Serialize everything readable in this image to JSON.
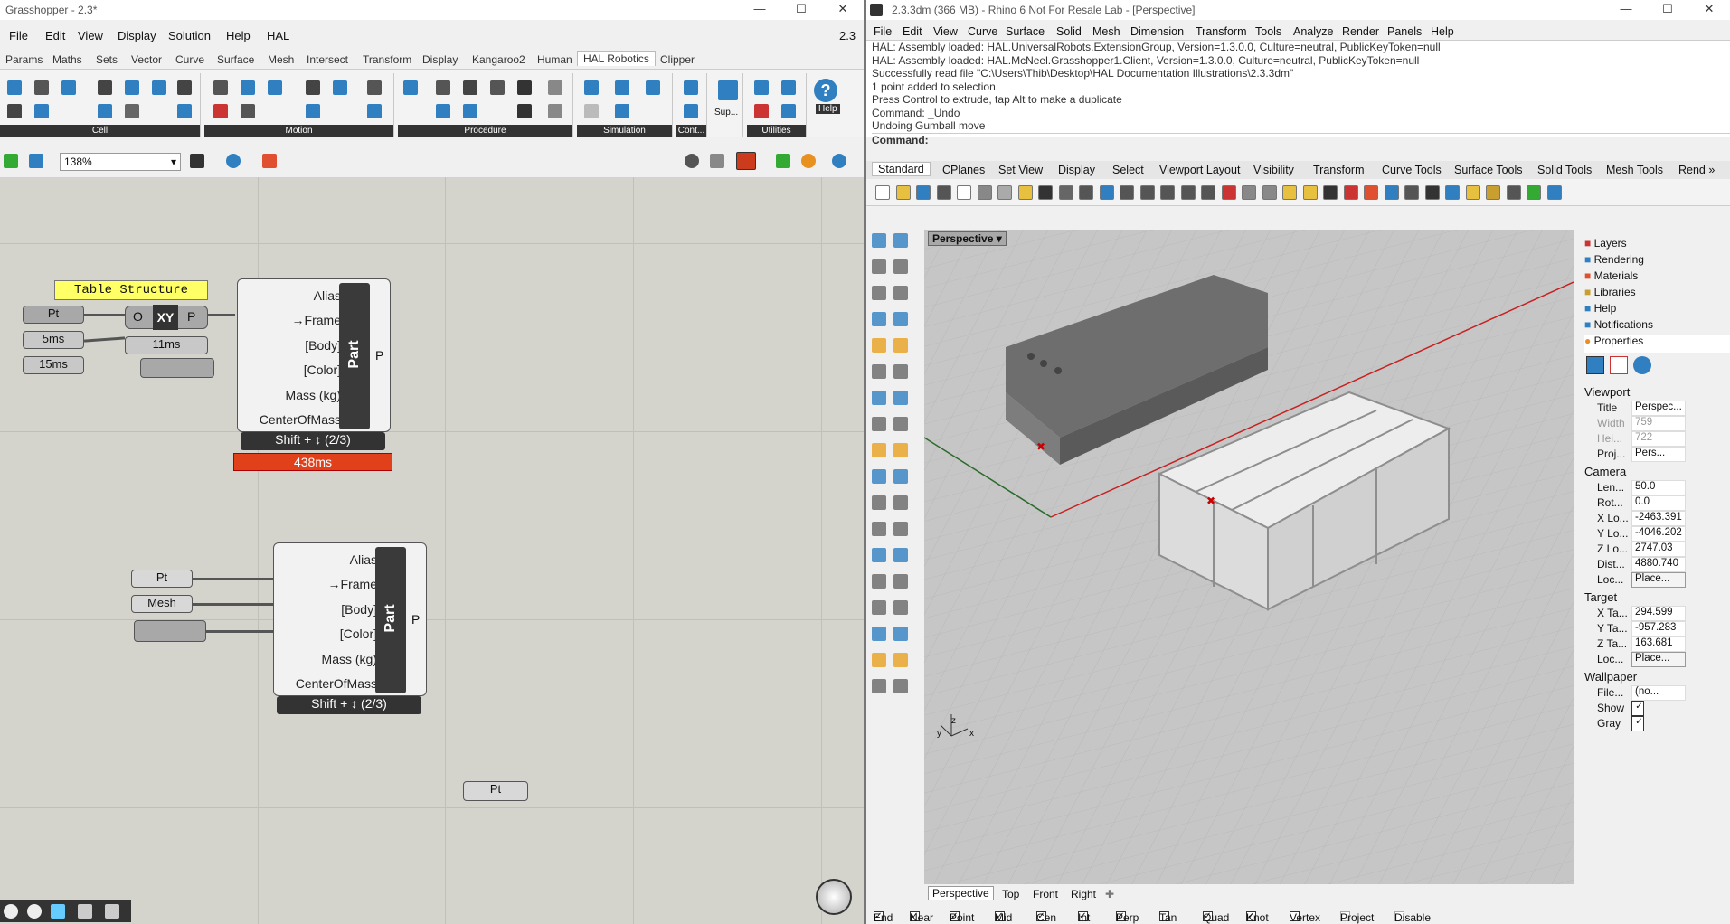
{
  "grasshopper": {
    "title": "Grasshopper - 2.3*",
    "version_badge": "2.3",
    "menu": [
      "File",
      "Edit",
      "View",
      "Display",
      "Solution",
      "Help",
      "HAL"
    ],
    "tabs": [
      "Params",
      "Maths",
      "Sets",
      "Vector",
      "Curve",
      "Surface",
      "Mesh",
      "Intersect",
      "Transform",
      "Display",
      "Kangaroo2",
      "Human",
      "HAL Robotics",
      "Clipper"
    ],
    "active_tab": "HAL Robotics",
    "groups": [
      "Cell",
      "Motion",
      "Procedure",
      "Simulation",
      "Cont...",
      "Utilities"
    ],
    "group_small_labels": {
      "sup": "Sup...",
      "cont": "Cont...",
      "help": "Help"
    },
    "zoom": "138%",
    "canvas": {
      "group_label": "Table Structure",
      "pt1": "Pt",
      "t5": "5ms",
      "t15": "15ms",
      "t11": "11ms",
      "xy_o": "O",
      "xy_p": "P",
      "part1": {
        "inputs": [
          "Alias",
          "→Frame",
          "[Body]",
          "[Color]",
          "Mass (kg)",
          "CenterOfMass"
        ],
        "name": "Part",
        "output": "P",
        "footer": "Shift + ↕ (2/3)",
        "timing": "438ms"
      },
      "part2": {
        "inputs": [
          "Alias",
          "→Frame",
          "[Body]",
          "[Color]",
          "Mass (kg)",
          "CenterOfMass"
        ],
        "name": "Part",
        "output": "P",
        "footer": "Shift + ↕ (2/3)"
      },
      "pt2": "Pt",
      "mesh": "Mesh",
      "pt3": "Pt"
    }
  },
  "rhino": {
    "title": "2.3.3dm (366 MB) - Rhino 6 Not For Resale Lab - [Perspective]",
    "menu": [
      "File",
      "Edit",
      "View",
      "Curve",
      "Surface",
      "Solid",
      "Mesh",
      "Dimension",
      "Transform",
      "Tools",
      "Analyze",
      "Render",
      "Panels",
      "Help"
    ],
    "log": [
      "HAL: Assembly loaded: HAL.UniversalRobots.ExtensionGroup, Version=1.3.0.0, Culture=neutral, PublicKeyToken=null",
      "HAL: Assembly loaded: HAL.McNeel.Grasshopper1.Client, Version=1.3.0.0, Culture=neutral, PublicKeyToken=null",
      "Successfully read file \"C:\\Users\\Thib\\Desktop\\HAL Documentation Illustrations\\2.3.3dm\"",
      "1 point added to selection.",
      "Press Control to extrude, tap Alt to make a duplicate",
      "Command: _Undo",
      "Undoing Gumball move"
    ],
    "command_label": "Command:",
    "toolbar_tabs": [
      "Standard",
      "CPlanes",
      "Set View",
      "Display",
      "Select",
      "Viewport Layout",
      "Visibility",
      "Transform",
      "Curve Tools",
      "Surface Tools",
      "Solid Tools",
      "Mesh Tools",
      "Rend »"
    ],
    "viewport_name": "Perspective",
    "panel_tabs": [
      "Layers",
      "Rendering",
      "Materials",
      "Libraries",
      "Help",
      "Notifications",
      "Properties"
    ],
    "properties": {
      "viewport_header": "Viewport",
      "viewport": [
        [
          "Title",
          "Perspec..."
        ],
        [
          "Width",
          "759"
        ],
        [
          "Hei...",
          "722"
        ],
        [
          "Proj...",
          "Pers..."
        ]
      ],
      "camera_header": "Camera",
      "camera": [
        [
          "Len...",
          "50.0"
        ],
        [
          "Rot...",
          "0.0"
        ],
        [
          "X Lo...",
          "-2463.391"
        ],
        [
          "Y Lo...",
          "-4046.202"
        ],
        [
          "Z Lo...",
          "2747.03"
        ],
        [
          "Dist...",
          "4880.740"
        ],
        [
          "Loc...",
          "Place..."
        ]
      ],
      "target_header": "Target",
      "target": [
        [
          "X Ta...",
          "294.599"
        ],
        [
          "Y Ta...",
          "-957.283"
        ],
        [
          "Z Ta...",
          "163.681"
        ],
        [
          "Loc...",
          "Place..."
        ]
      ],
      "wallpaper_header": "Wallpaper",
      "wallpaper": [
        [
          "File...",
          "(no..."
        ],
        [
          "Show",
          ""
        ],
        [
          "Gray",
          ""
        ]
      ]
    },
    "view_tabs": [
      "Perspective",
      "Top",
      "Front",
      "Right"
    ],
    "osnaps": [
      [
        "End",
        true
      ],
      [
        "Near",
        true
      ],
      [
        "Point",
        true
      ],
      [
        "Mid",
        true
      ],
      [
        "Cen",
        true
      ],
      [
        "Int",
        true
      ],
      [
        "Perp",
        true
      ],
      [
        "Tan",
        false
      ],
      [
        "Quad",
        true
      ],
      [
        "Knot",
        true
      ],
      [
        "Vertex",
        false
      ],
      [
        "Project",
        false
      ],
      [
        "Disable",
        false
      ]
    ],
    "axis": {
      "x": "x",
      "y": "y",
      "z": "z"
    }
  }
}
